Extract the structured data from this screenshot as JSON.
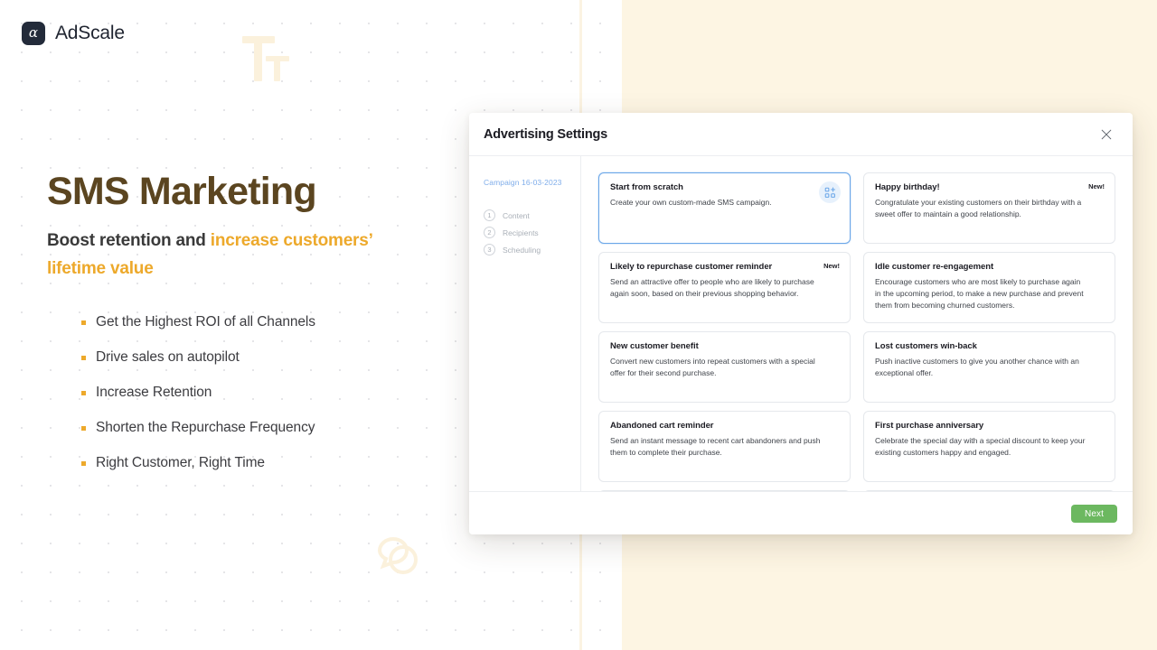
{
  "brand": {
    "logo_glyph": "α",
    "name": "AdScale"
  },
  "hero": {
    "headline": "SMS Marketing",
    "subhead_plain": "Boost retention and ",
    "subhead_accent": "increase customers’ lifetime value",
    "accent_color": "#eda92b",
    "headline_color": "#5b4520",
    "bullets": [
      {
        "label": "Get the Highest ROI of all Channels"
      },
      {
        "label": "Drive sales on autopilot"
      },
      {
        "label": "Increase Retention"
      },
      {
        "label": "Shorten the Repurchase Frequency"
      },
      {
        "label": "Right Customer, Right Time"
      }
    ]
  },
  "watermarks": {
    "typography_icon": "text-format-icon",
    "chat_icon": "chat-bubbles-icon",
    "color": "#fbf1dc"
  },
  "modal": {
    "title": "Advertising Settings",
    "close_icon": "close-icon",
    "sidebar": {
      "campaign_label": "Campaign 16-03-2023",
      "campaign_color": "#7fadea",
      "steps": [
        {
          "num": "1",
          "label": "Content"
        },
        {
          "num": "2",
          "label": "Recipients"
        },
        {
          "num": "3",
          "label": "Scheduling"
        }
      ]
    },
    "cards": [
      {
        "title": "Start from scratch",
        "desc": "Create your own custom-made SMS campaign.",
        "badge": "",
        "icon": "add-grid-icon",
        "selected": true
      },
      {
        "title": "Happy birthday!",
        "desc": "Congratulate your existing customers on their birthday with a sweet offer to maintain a good relationship.",
        "badge": "New!",
        "icon": "",
        "selected": false
      },
      {
        "title": "Likely to repurchase customer reminder",
        "desc": "Send an attractive offer to people who are likely to purchase again soon, based on their previous shopping behavior.",
        "badge": "New!",
        "icon": "",
        "selected": false
      },
      {
        "title": "Idle customer re-engagement",
        "desc": "Encourage customers who are most likely to purchase again in the upcoming period, to make a new purchase and prevent them from becoming churned customers.",
        "badge": "",
        "icon": "",
        "selected": false
      },
      {
        "title": "New customer benefit",
        "desc": "Convert new customers into repeat customers with a special offer for their second purchase.",
        "badge": "",
        "icon": "",
        "selected": false
      },
      {
        "title": "Lost customers win-back",
        "desc": "Push inactive customers to give you another chance with an exceptional offer.",
        "badge": "",
        "icon": "",
        "selected": false
      },
      {
        "title": "Abandoned cart reminder",
        "desc": "Send an instant message to recent cart abandoners and push them to complete their purchase.",
        "badge": "",
        "icon": "",
        "selected": false
      },
      {
        "title": "First purchase anniversary",
        "desc": "Celebrate the special day with a special discount to keep your existing customers happy and engaged.",
        "badge": "",
        "icon": "",
        "selected": false
      },
      {
        "title": "",
        "desc": "",
        "badge": "",
        "icon": "",
        "selected": false
      },
      {
        "title": "",
        "desc": "",
        "badge": "",
        "icon": "",
        "selected": false
      }
    ],
    "footer": {
      "next_label": "Next",
      "next_color": "#6cb860"
    }
  }
}
